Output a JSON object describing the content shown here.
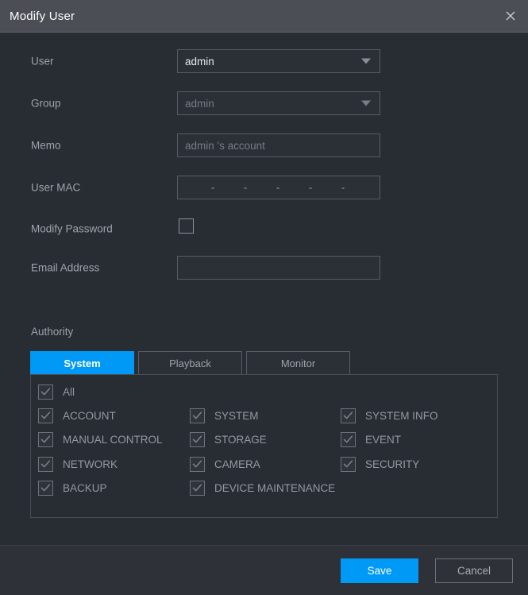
{
  "window": {
    "title": "Modify User",
    "close_icon": "close-icon"
  },
  "form": {
    "rows": [
      {
        "label": "User",
        "type": "select",
        "value": "admin",
        "disabled": false
      },
      {
        "label": "Group",
        "type": "select",
        "value": "admin",
        "disabled": true
      },
      {
        "label": "Memo",
        "type": "text",
        "value": "admin 's account",
        "disabled": true
      },
      {
        "label": "User MAC",
        "type": "mac",
        "value": "",
        "disabled": false
      },
      {
        "label": "Modify Password",
        "type": "checkbox",
        "checked": false
      },
      {
        "label": "Email Address",
        "type": "text",
        "value": "",
        "disabled": false
      }
    ],
    "mac_separator": "-",
    "mac_separator_count": 5
  },
  "authority": {
    "label": "Authority",
    "tabs": [
      {
        "label": "System",
        "active": true
      },
      {
        "label": "Playback",
        "active": false
      },
      {
        "label": "Monitor",
        "active": false
      }
    ],
    "permissions": [
      {
        "label": "All",
        "checked": true,
        "col": 0,
        "row": 0
      },
      {
        "label": "ACCOUNT",
        "checked": true,
        "col": 0,
        "row": 1
      },
      {
        "label": "SYSTEM",
        "checked": true,
        "col": 1,
        "row": 1
      },
      {
        "label": "SYSTEM INFO",
        "checked": true,
        "col": 2,
        "row": 1
      },
      {
        "label": "MANUAL CONTROL",
        "checked": true,
        "col": 0,
        "row": 2
      },
      {
        "label": "STORAGE",
        "checked": true,
        "col": 1,
        "row": 2
      },
      {
        "label": "EVENT",
        "checked": true,
        "col": 2,
        "row": 2
      },
      {
        "label": "NETWORK",
        "checked": true,
        "col": 0,
        "row": 3
      },
      {
        "label": "CAMERA",
        "checked": true,
        "col": 1,
        "row": 3
      },
      {
        "label": "SECURITY",
        "checked": true,
        "col": 2,
        "row": 3
      },
      {
        "label": "BACKUP",
        "checked": true,
        "col": 0,
        "row": 4
      },
      {
        "label": "DEVICE MAINTENANCE",
        "checked": true,
        "col": 1,
        "row": 4
      }
    ]
  },
  "footer": {
    "save_label": "Save",
    "cancel_label": "Cancel"
  },
  "colors": {
    "accent": "#0099f5",
    "titlebar": "#4b4f55",
    "body": "#282c33",
    "footer": "#2e3238",
    "label_text": "#9ea3ab",
    "value_text": "#e8eaed",
    "muted_text": "#777c85",
    "border": "#575b63"
  }
}
